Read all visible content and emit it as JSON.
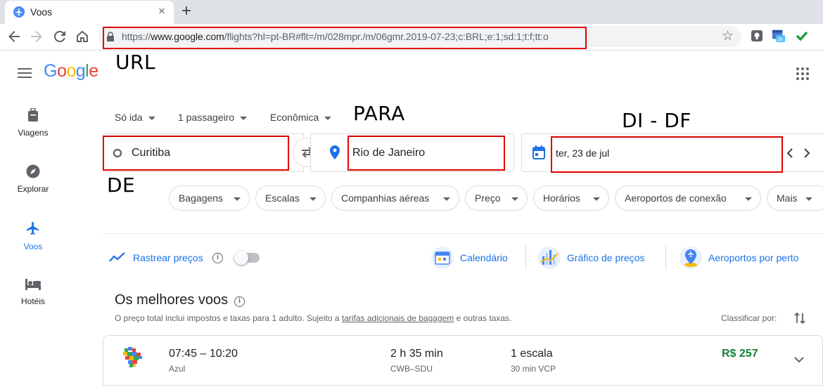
{
  "browser": {
    "tab_title": "Voos",
    "tab_close": "×",
    "new_tab": "+",
    "url_scheme": "https://",
    "url_host": "www.google.com",
    "url_path": "/flights?hl=pt-BR#flt=/m/028mpr./m/06gmr.2019-07-23;c:BRL;e:1;sd:1;t:f;tt:o",
    "bookmark_star": "☆"
  },
  "annotations": {
    "url": "URL",
    "para": "PARA",
    "de": "DE",
    "di_df": "DI - DF"
  },
  "logo": [
    "G",
    "o",
    "o",
    "g",
    "l",
    "e"
  ],
  "sidebar": {
    "items": [
      {
        "label": "Viagens"
      },
      {
        "label": "Explorar"
      },
      {
        "label": "Voos"
      },
      {
        "label": "Hotéis"
      }
    ]
  },
  "search": {
    "trip_type": "Só ida",
    "passengers": "1 passageiro",
    "cabin": "Econômica",
    "origin": "Curitiba",
    "destination": "Rio de Janeiro",
    "date": "ter, 23 de jul"
  },
  "filters": [
    "Bagagens",
    "Escalas",
    "Companhias aéreas",
    "Preço",
    "Horários",
    "Aeroportos de conexão",
    "Mais"
  ],
  "tools": {
    "track_prices": "Rastrear preços",
    "calendar": "Calendário",
    "price_graph": "Gráfico de preços",
    "nearby_airports": "Aeroportos por perto"
  },
  "results": {
    "title": "Os melhores voos",
    "disclaimer_pre": "O preço total inclui impostos e taxas para 1 adulto. Sujeito a ",
    "disclaimer_link": "tarifas adicionais de bagagem",
    "disclaimer_post": " e outras taxas.",
    "sort_label": "Classificar por:",
    "flights": [
      {
        "times": "07:45 – 10:20",
        "airline": "Azul",
        "duration": "2 h 35 min",
        "route": "CWB–SDU",
        "stops": "1 escala",
        "layover": "30 min VCP",
        "price": "R$ 257"
      }
    ]
  },
  "colors": {
    "accent": "#1a73e8",
    "price_green": "#188038",
    "annotation_red": "#e00000"
  }
}
